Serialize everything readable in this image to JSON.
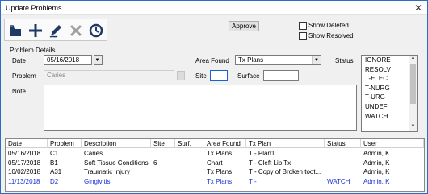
{
  "window": {
    "title": "Update Problems",
    "close_glyph": "✕"
  },
  "toolbar": {
    "buttons": [
      {
        "name": "open-icon"
      },
      {
        "name": "add-icon"
      },
      {
        "name": "edit-icon"
      },
      {
        "name": "delete-icon"
      },
      {
        "name": "history-icon"
      }
    ]
  },
  "actions": {
    "approve": "Approve"
  },
  "filters": {
    "show_deleted": "Show Deleted",
    "show_resolved": "Show Resolved"
  },
  "details": {
    "group_label": "Problem Details",
    "date_label": "Date",
    "date_value": "05/16/2018",
    "area_found_label": "Area Found",
    "area_found_value": "Tx Plans",
    "status_label": "Status",
    "problem_label": "Problem",
    "problem_value": "Caries",
    "site_label": "Site",
    "site_value": "",
    "surface_label": "Surface",
    "surface_value": "",
    "note_label": "Note"
  },
  "status_options": [
    "IGNORE",
    "RESOLV",
    "T-ELEC",
    "T-NURG",
    "T-URG",
    "UNDEF",
    "WATCH"
  ],
  "grid": {
    "columns": [
      "Date",
      "Problem",
      "Description",
      "Site",
      "Surf.",
      "Area Found",
      "Tx Plan",
      "Status",
      "User"
    ],
    "rows": [
      {
        "cells": [
          "05/16/2018",
          "C1",
          "Caries",
          "",
          "",
          "Tx Plans",
          "T - Plan1",
          "",
          "Admin, K"
        ],
        "highlight": false
      },
      {
        "cells": [
          "05/17/2018",
          "B1",
          "Soft Tissue Conditions",
          "6",
          "",
          "Chart",
          "T - Cleft Lip Tx",
          "",
          "Admin, K"
        ],
        "highlight": false
      },
      {
        "cells": [
          "10/02/2018",
          "A31",
          "Traumatic Injury",
          "",
          "",
          "Tx Plans",
          "T - Copy of Broken toot...",
          "",
          "Admin, K"
        ],
        "highlight": false
      },
      {
        "cells": [
          "11/13/2018",
          "D2",
          "Gingivitis",
          "",
          "",
          "Tx Plans",
          "T -",
          "WATCH",
          "Admin, K"
        ],
        "highlight": true
      }
    ]
  },
  "colors": {
    "highlight_text": "#1a2fd6",
    "toolbar_icon": "#1f3a66"
  }
}
